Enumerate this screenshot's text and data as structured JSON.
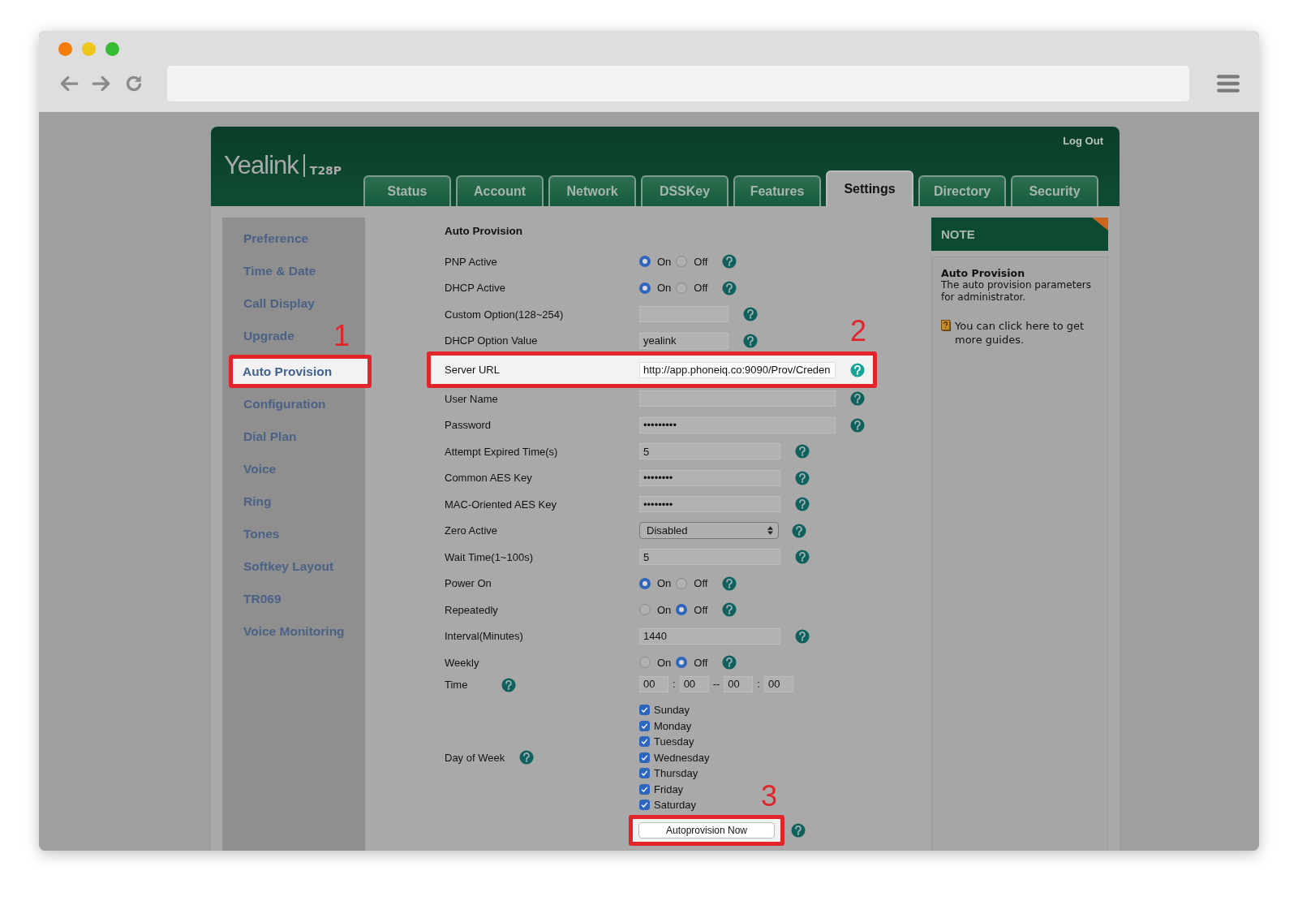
{
  "header": {
    "logo": "Yealink",
    "model": "T28P",
    "logout": "Log Out"
  },
  "tabs": [
    {
      "label": "Status",
      "selected": false
    },
    {
      "label": "Account",
      "selected": false
    },
    {
      "label": "Network",
      "selected": false
    },
    {
      "label": "DSSKey",
      "selected": false
    },
    {
      "label": "Features",
      "selected": false
    },
    {
      "label": "Settings",
      "selected": true
    },
    {
      "label": "Directory",
      "selected": false
    },
    {
      "label": "Security",
      "selected": false
    }
  ],
  "sidebar": {
    "items": [
      {
        "label": "Preference",
        "selected": false
      },
      {
        "label": "Time & Date",
        "selected": false
      },
      {
        "label": "Call Display",
        "selected": false
      },
      {
        "label": "Upgrade",
        "selected": false
      },
      {
        "label": "Auto Provision",
        "selected": true,
        "callout": "1"
      },
      {
        "label": "Configuration",
        "selected": false
      },
      {
        "label": "Dial Plan",
        "selected": false
      },
      {
        "label": "Voice",
        "selected": false
      },
      {
        "label": "Ring",
        "selected": false
      },
      {
        "label": "Tones",
        "selected": false
      },
      {
        "label": "Softkey Layout",
        "selected": false
      },
      {
        "label": "TR069",
        "selected": false
      },
      {
        "label": "Voice Monitoring",
        "selected": false
      }
    ]
  },
  "form": {
    "title": "Auto Provision",
    "rows": [
      {
        "kind": "radio",
        "label": "PNP Active",
        "options": [
          {
            "label": "On",
            "selected": true
          },
          {
            "label": "Off",
            "selected": false
          }
        ]
      },
      {
        "kind": "radio",
        "label": "DHCP Active",
        "options": [
          {
            "label": "On",
            "selected": true
          },
          {
            "label": "Off",
            "selected": false
          }
        ]
      },
      {
        "kind": "short",
        "label": "Custom Option(128~254)"
      },
      {
        "kind": "short",
        "label": "DHCP Option Value",
        "value": "yealink"
      },
      {
        "kind": "long",
        "label": "Server URL",
        "value": "http://app.phoneiq.co:9090/Prov/Creden",
        "callout": "2"
      },
      {
        "kind": "long",
        "label": "User Name"
      },
      {
        "kind": "long",
        "label": "Password",
        "value": "•••••••••"
      },
      {
        "kind": "medium",
        "label": "Attempt Expired Time(s)",
        "value": "5"
      },
      {
        "kind": "medium",
        "label": "Common AES Key",
        "value": "••••••••"
      },
      {
        "kind": "medium",
        "label": "MAC-Oriented AES Key",
        "value": "••••••••"
      },
      {
        "kind": "select",
        "label": "Zero Active",
        "value": "Disabled"
      },
      {
        "kind": "medium",
        "label": "Wait Time(1~100s)",
        "value": "5"
      },
      {
        "kind": "radio",
        "label": "Power On",
        "options": [
          {
            "label": "On",
            "selected": true
          },
          {
            "label": "Off",
            "selected": false
          }
        ]
      },
      {
        "kind": "radio",
        "label": "Repeatedly",
        "options": [
          {
            "label": "On",
            "selected": false
          },
          {
            "label": "Off",
            "selected": true
          }
        ]
      },
      {
        "kind": "medium",
        "label": "Interval(Minutes)",
        "value": "1440"
      },
      {
        "kind": "radio",
        "label": "Weekly",
        "options": [
          {
            "label": "On",
            "selected": false
          },
          {
            "label": "Off",
            "selected": true
          }
        ]
      },
      {
        "kind": "time",
        "label": "Time",
        "values": [
          "00",
          "00",
          "00",
          "00"
        ],
        "separators": [
          ":",
          "--",
          ":"
        ]
      },
      {
        "kind": "days",
        "label": "Day of Week",
        "days": [
          {
            "label": "Sunday",
            "checked": true
          },
          {
            "label": "Monday",
            "checked": true
          },
          {
            "label": "Tuesday",
            "checked": true
          },
          {
            "label": "Wednesday",
            "checked": true
          },
          {
            "label": "Thursday",
            "checked": true
          },
          {
            "label": "Friday",
            "checked": true
          },
          {
            "label": "Saturday",
            "checked": true
          }
        ]
      },
      {
        "kind": "button",
        "label": "Autoprovision Now",
        "callout": "3"
      }
    ]
  },
  "note": {
    "title": "NOTE",
    "heading": "Auto Provision",
    "text": "The auto provision parameters for administrator.",
    "link": "You can click here to get more guides."
  }
}
